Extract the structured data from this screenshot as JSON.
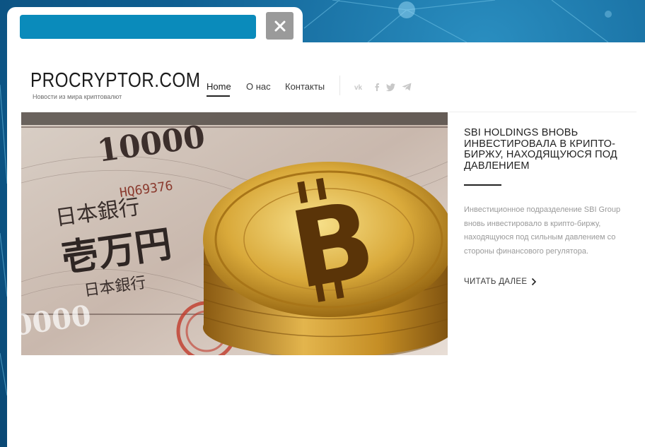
{
  "window": {
    "close_icon": "close-icon"
  },
  "site": {
    "logo": "PROCRYPTOR.COM",
    "tagline": "Новости из мира криптовалют"
  },
  "nav": {
    "items": [
      {
        "label": "Home",
        "active": true
      },
      {
        "label": "О нас",
        "active": false
      },
      {
        "label": "Контакты",
        "active": false
      }
    ],
    "social_icons": [
      "vk-icon",
      "facebook-icon",
      "twitter-icon",
      "telegram-icon"
    ]
  },
  "hero": {
    "image": "bitcoin-coins-on-yen-banknotes"
  },
  "article": {
    "title": "SBI HOLDINGS ВНОВЬ ИНВЕСТИРОВАЛА В КРИПТО-БИРЖУ, НАХОДЯЩУЮСЯ ПОД ДАВЛЕНИЕМ",
    "excerpt": "Инвестиционное подразделение SBI Group вновь инвестировало в крипто-биржу, находящуюся под сильным давлением со стороны финансового регулятора.",
    "read_more": "ЧИТАТЬ ДАЛЕЕ"
  },
  "colors": {
    "background": "#0f5f92",
    "url_bar": "#0a8bbb",
    "close_button": "#9a9a9a",
    "social_icon": "#c8c8c8",
    "excerpt_text": "#9a9a9a"
  }
}
